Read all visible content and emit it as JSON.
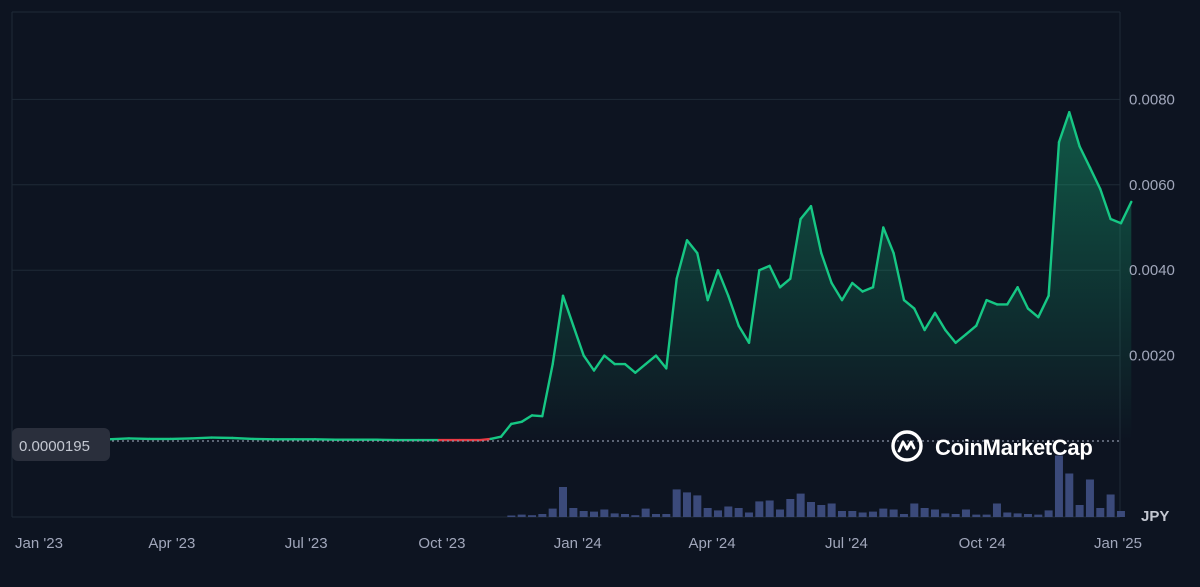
{
  "chart_data": {
    "type": "line",
    "title": "",
    "xlabel": "",
    "ylabel": "",
    "currency_label": "JPY",
    "current_value_label": "0.0000195",
    "watermark": "CoinMarketCap",
    "y_ticks": [
      {
        "value": 0.002,
        "label": "0.0020"
      },
      {
        "value": 0.004,
        "label": "0.0040"
      },
      {
        "value": 0.006,
        "label": "0.0060"
      },
      {
        "value": 0.008,
        "label": "0.0080"
      }
    ],
    "ylim": [
      -1e-05,
      0.0101
    ],
    "x_ticks": [
      {
        "date": "2023-01-01",
        "label": "Jan '23"
      },
      {
        "date": "2023-04-01",
        "label": "Apr '23"
      },
      {
        "date": "2023-07-01",
        "label": "Jul '23"
      },
      {
        "date": "2023-10-01",
        "label": "Oct '23"
      },
      {
        "date": "2024-01-01",
        "label": "Jan '24"
      },
      {
        "date": "2024-04-01",
        "label": "Apr '24"
      },
      {
        "date": "2024-07-01",
        "label": "Jul '24"
      },
      {
        "date": "2024-10-01",
        "label": "Oct '24"
      },
      {
        "date": "2025-01-01",
        "label": "Jan '25"
      }
    ],
    "grid": true,
    "colors": {
      "background": "#0d1421",
      "line_up": "#16c784",
      "line_down": "#ea3943",
      "grid": "#1f2a37",
      "volume": "#3b4a7a",
      "axis_text": "#a1a7bb",
      "reference_line": "#8c93a6"
    },
    "series": [
      {
        "values": [
          [
            "2023-01-06",
            2e-05
          ],
          [
            "2023-01-20",
            3e-05
          ],
          [
            "2023-02-03",
            3e-05
          ],
          [
            "2023-02-17",
            4e-05
          ],
          [
            "2023-03-03",
            6e-05
          ],
          [
            "2023-03-17",
            5e-05
          ],
          [
            "2023-03-31",
            5e-05
          ],
          [
            "2023-04-14",
            6e-05
          ],
          [
            "2023-04-28",
            8e-05
          ],
          [
            "2023-05-12",
            7e-05
          ],
          [
            "2023-05-26",
            5e-05
          ],
          [
            "2023-06-09",
            4e-05
          ],
          [
            "2023-06-23",
            4e-05
          ],
          [
            "2023-07-07",
            4e-05
          ],
          [
            "2023-07-21",
            3e-05
          ],
          [
            "2023-08-04",
            3e-05
          ],
          [
            "2023-08-18",
            3e-05
          ],
          [
            "2023-09-01",
            2e-05
          ],
          [
            "2023-09-15",
            2e-05
          ],
          [
            "2023-09-29",
            2e-05
          ],
          [
            "2023-10-13",
            2e-05
          ],
          [
            "2023-10-27",
            2e-05
          ],
          [
            "2023-11-03",
            5e-05
          ],
          [
            "2023-11-10",
            0.0001
          ],
          [
            "2023-11-17",
            0.0004
          ],
          [
            "2023-11-24",
            0.00045
          ],
          [
            "2023-12-01",
            0.0006
          ],
          [
            "2023-12-08",
            0.00058
          ],
          [
            "2023-12-15",
            0.0018
          ],
          [
            "2023-12-22",
            0.0034
          ],
          [
            "2023-12-29",
            0.0027
          ],
          [
            "2024-01-05",
            0.002
          ],
          [
            "2024-01-12",
            0.00165
          ],
          [
            "2024-01-19",
            0.002
          ],
          [
            "2024-01-26",
            0.0018
          ],
          [
            "2024-02-02",
            0.0018
          ],
          [
            "2024-02-09",
            0.0016
          ],
          [
            "2024-02-16",
            0.0018
          ],
          [
            "2024-02-23",
            0.002
          ],
          [
            "2024-03-01",
            0.0017
          ],
          [
            "2024-03-08",
            0.0038
          ],
          [
            "2024-03-15",
            0.0047
          ],
          [
            "2024-03-22",
            0.0044
          ],
          [
            "2024-03-29",
            0.0033
          ],
          [
            "2024-04-05",
            0.004
          ],
          [
            "2024-04-12",
            0.0034
          ],
          [
            "2024-04-19",
            0.0027
          ],
          [
            "2024-04-26",
            0.0023
          ],
          [
            "2024-05-03",
            0.004
          ],
          [
            "2024-05-10",
            0.0041
          ],
          [
            "2024-05-17",
            0.0036
          ],
          [
            "2024-05-24",
            0.0038
          ],
          [
            "2024-05-31",
            0.0052
          ],
          [
            "2024-06-07",
            0.0055
          ],
          [
            "2024-06-14",
            0.0044
          ],
          [
            "2024-06-21",
            0.0037
          ],
          [
            "2024-06-28",
            0.0033
          ],
          [
            "2024-07-05",
            0.0037
          ],
          [
            "2024-07-12",
            0.0035
          ],
          [
            "2024-07-19",
            0.0036
          ],
          [
            "2024-07-26",
            0.005
          ],
          [
            "2024-08-02",
            0.0044
          ],
          [
            "2024-08-09",
            0.0033
          ],
          [
            "2024-08-16",
            0.0031
          ],
          [
            "2024-08-23",
            0.0026
          ],
          [
            "2024-08-30",
            0.003
          ],
          [
            "2024-09-06",
            0.0026
          ],
          [
            "2024-09-13",
            0.0023
          ],
          [
            "2024-09-20",
            0.0025
          ],
          [
            "2024-09-27",
            0.0027
          ],
          [
            "2024-10-04",
            0.0033
          ],
          [
            "2024-10-11",
            0.0032
          ],
          [
            "2024-10-18",
            0.0032
          ],
          [
            "2024-10-25",
            0.0036
          ],
          [
            "2024-11-01",
            0.0031
          ],
          [
            "2024-11-08",
            0.0029
          ],
          [
            "2024-11-15",
            0.0034
          ],
          [
            "2024-11-22",
            0.007
          ],
          [
            "2024-11-29",
            0.0077
          ],
          [
            "2024-12-06",
            0.0069
          ],
          [
            "2024-12-13",
            0.0064
          ],
          [
            "2024-12-20",
            0.0059
          ],
          [
            "2024-12-27",
            0.0052
          ],
          [
            "2025-01-03",
            0.0051
          ],
          [
            "2025-01-10",
            0.0056
          ]
        ]
      }
    ],
    "volume": [
      [
        "2023-11-17",
        0.05
      ],
      [
        "2023-11-24",
        0.08
      ],
      [
        "2023-12-01",
        0.06
      ],
      [
        "2023-12-08",
        0.1
      ],
      [
        "2023-12-15",
        0.28
      ],
      [
        "2023-12-22",
        1.0
      ],
      [
        "2023-12-29",
        0.3
      ],
      [
        "2024-01-05",
        0.2
      ],
      [
        "2024-01-12",
        0.18
      ],
      [
        "2024-01-19",
        0.25
      ],
      [
        "2024-01-26",
        0.12
      ],
      [
        "2024-02-02",
        0.1
      ],
      [
        "2024-02-09",
        0.06
      ],
      [
        "2024-02-16",
        0.28
      ],
      [
        "2024-02-23",
        0.1
      ],
      [
        "2024-03-01",
        0.1
      ],
      [
        "2024-03-08",
        0.92
      ],
      [
        "2024-03-15",
        0.82
      ],
      [
        "2024-03-22",
        0.72
      ],
      [
        "2024-03-29",
        0.3
      ],
      [
        "2024-04-05",
        0.22
      ],
      [
        "2024-04-12",
        0.35
      ],
      [
        "2024-04-19",
        0.3
      ],
      [
        "2024-04-26",
        0.15
      ],
      [
        "2024-05-03",
        0.52
      ],
      [
        "2024-05-10",
        0.55
      ],
      [
        "2024-05-17",
        0.25
      ],
      [
        "2024-05-24",
        0.6
      ],
      [
        "2024-05-31",
        0.78
      ],
      [
        "2024-06-07",
        0.5
      ],
      [
        "2024-06-14",
        0.4
      ],
      [
        "2024-06-21",
        0.45
      ],
      [
        "2024-06-28",
        0.2
      ],
      [
        "2024-07-05",
        0.2
      ],
      [
        "2024-07-12",
        0.15
      ],
      [
        "2024-07-19",
        0.18
      ],
      [
        "2024-07-26",
        0.28
      ],
      [
        "2024-08-02",
        0.25
      ],
      [
        "2024-08-09",
        0.1
      ],
      [
        "2024-08-16",
        0.45
      ],
      [
        "2024-08-23",
        0.3
      ],
      [
        "2024-08-30",
        0.25
      ],
      [
        "2024-09-06",
        0.12
      ],
      [
        "2024-09-13",
        0.1
      ],
      [
        "2024-09-20",
        0.25
      ],
      [
        "2024-09-27",
        0.08
      ],
      [
        "2024-10-04",
        0.08
      ],
      [
        "2024-10-11",
        0.45
      ],
      [
        "2024-10-18",
        0.15
      ],
      [
        "2024-10-25",
        0.12
      ],
      [
        "2024-11-01",
        0.1
      ],
      [
        "2024-11-08",
        0.08
      ],
      [
        "2024-11-15",
        0.22
      ],
      [
        "2024-11-22",
        2.05
      ],
      [
        "2024-11-29",
        1.45
      ],
      [
        "2024-12-06",
        0.4
      ],
      [
        "2024-12-13",
        1.25
      ],
      [
        "2024-12-20",
        0.3
      ],
      [
        "2024-12-27",
        0.75
      ],
      [
        "2025-01-03",
        0.2
      ]
    ]
  }
}
